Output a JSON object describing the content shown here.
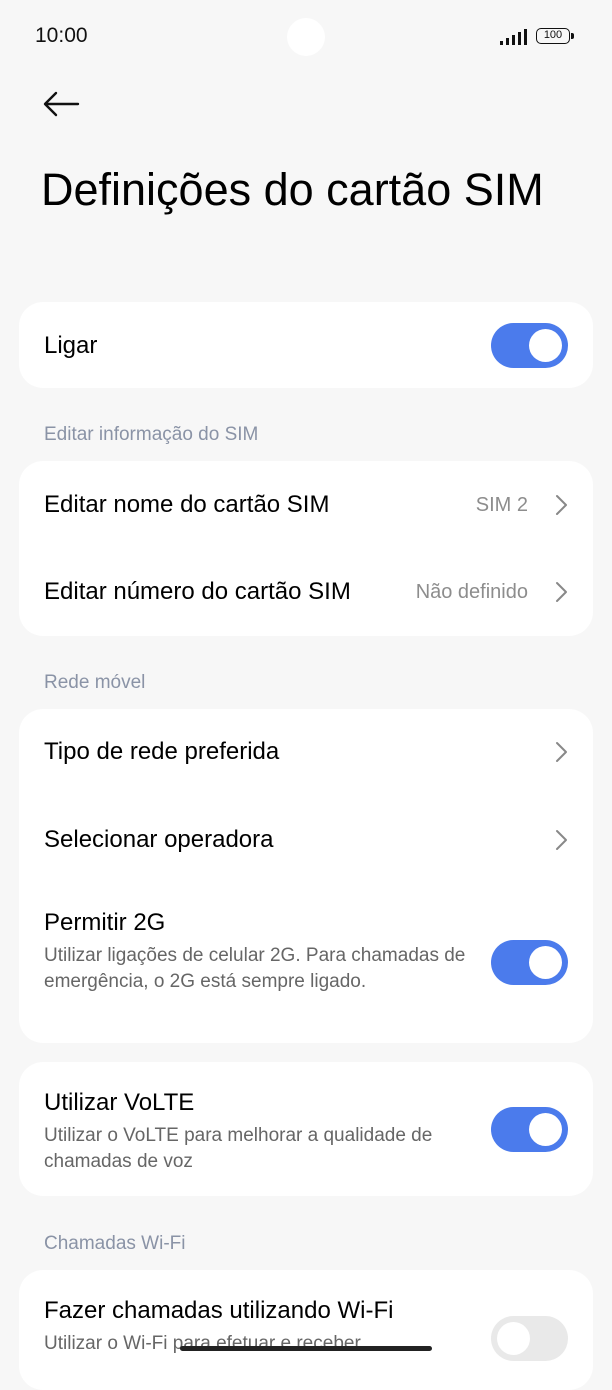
{
  "status_bar": {
    "time": "10:00",
    "battery": "100"
  },
  "page": {
    "title": "Definições do cartão SIM"
  },
  "power": {
    "label": "Ligar",
    "on": true
  },
  "sections": {
    "sim_info": "Editar informação do SIM",
    "mobile_network": "Rede móvel",
    "wifi_calling": "Chamadas Wi-Fi"
  },
  "sim_info": {
    "edit_name_label": "Editar nome do cartão SIM",
    "edit_name_value": "SIM 2",
    "edit_number_label": "Editar número do cartão SIM",
    "edit_number_value": "Não definido"
  },
  "mobile_network": {
    "preferred_type_label": "Tipo de rede preferida",
    "select_operator_label": "Selecionar operadora",
    "allow_2g_label": "Permitir 2G",
    "allow_2g_desc": "Utilizar ligações de celular 2G. Para chamadas de emergência, o 2G está sempre ligado.",
    "allow_2g_on": true
  },
  "volte": {
    "label": "Utilizar VoLTE",
    "desc": "Utilizar o VoLTE para melhorar a qualidade de chamadas de voz",
    "on": true
  },
  "wifi_calling": {
    "label": "Fazer chamadas utilizando Wi-Fi",
    "desc": "Utilizar o Wi-Fi para efetuar e receber",
    "on": false
  }
}
